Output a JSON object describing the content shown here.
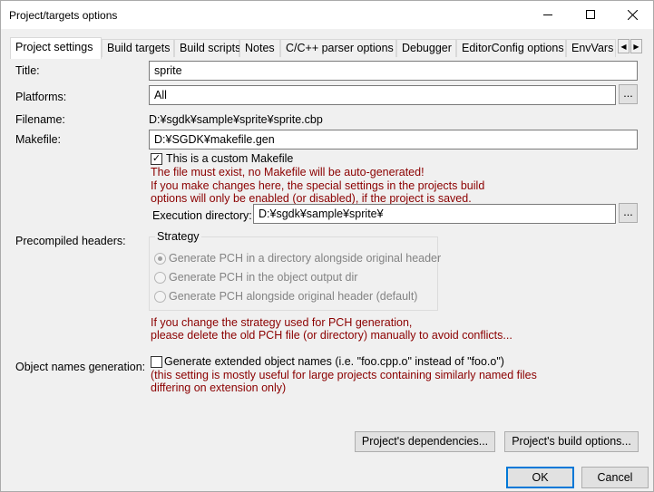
{
  "window": {
    "title": "Project/targets options"
  },
  "tabs": [
    {
      "label": "Project settings"
    },
    {
      "label": "Build targets"
    },
    {
      "label": "Build scripts"
    },
    {
      "label": "Notes"
    },
    {
      "label": "C/C++ parser options"
    },
    {
      "label": "Debugger"
    },
    {
      "label": "EditorConfig options"
    },
    {
      "label": "EnvVars"
    }
  ],
  "form": {
    "title_label": "Title:",
    "title_value": "sprite",
    "platforms_label": "Platforms:",
    "platforms_value": "All",
    "browse_label": "...",
    "filename_label": "Filename:",
    "filename_value": "D:¥sgdk¥sample¥sprite¥sprite.cbp",
    "makefile_label": "Makefile:",
    "makefile_value": "D:¥SGDK¥makefile.gen",
    "custom_makefile_label": "This is a custom Makefile",
    "custom_makefile_checked": true,
    "warning_line1": "The file must exist, no Makefile will be auto-generated!",
    "warning_line2": "If you make changes here, the special settings in the projects build",
    "warning_line3": "options will only be enabled (or disabled), if the project is saved.",
    "exec_dir_label": "Execution directory:",
    "exec_dir_value": "D:¥sgdk¥sample¥sprite¥",
    "pch_label": "Precompiled headers:",
    "strategy_label": "Strategy",
    "strategy_options": [
      {
        "label": "Generate PCH in a directory alongside original header",
        "selected": true
      },
      {
        "label": "Generate PCH in the object output dir",
        "selected": false
      },
      {
        "label": "Generate PCH alongside original header (default)",
        "selected": false
      }
    ],
    "pch_note_line1": "If you change the strategy used for PCH generation,",
    "pch_note_line2": "please delete the old PCH file (or directory) manually to avoid conflicts...",
    "objnames_label": "Object names generation:",
    "extended_names_label": "Generate extended object names (i.e. \"foo.cpp.o\" instead of \"foo.o\")",
    "extended_names_checked": false,
    "objnames_note_line1": "(this setting is mostly useful for large projects containing similarly named files",
    "objnames_note_line2": "differing on extension only)"
  },
  "buttons": {
    "dependencies": "Project's dependencies...",
    "build_options": "Project's build options...",
    "ok": "OK",
    "cancel": "Cancel"
  },
  "colors": {
    "warning_text": "#8b0000",
    "ok_border": "#0078d7"
  }
}
